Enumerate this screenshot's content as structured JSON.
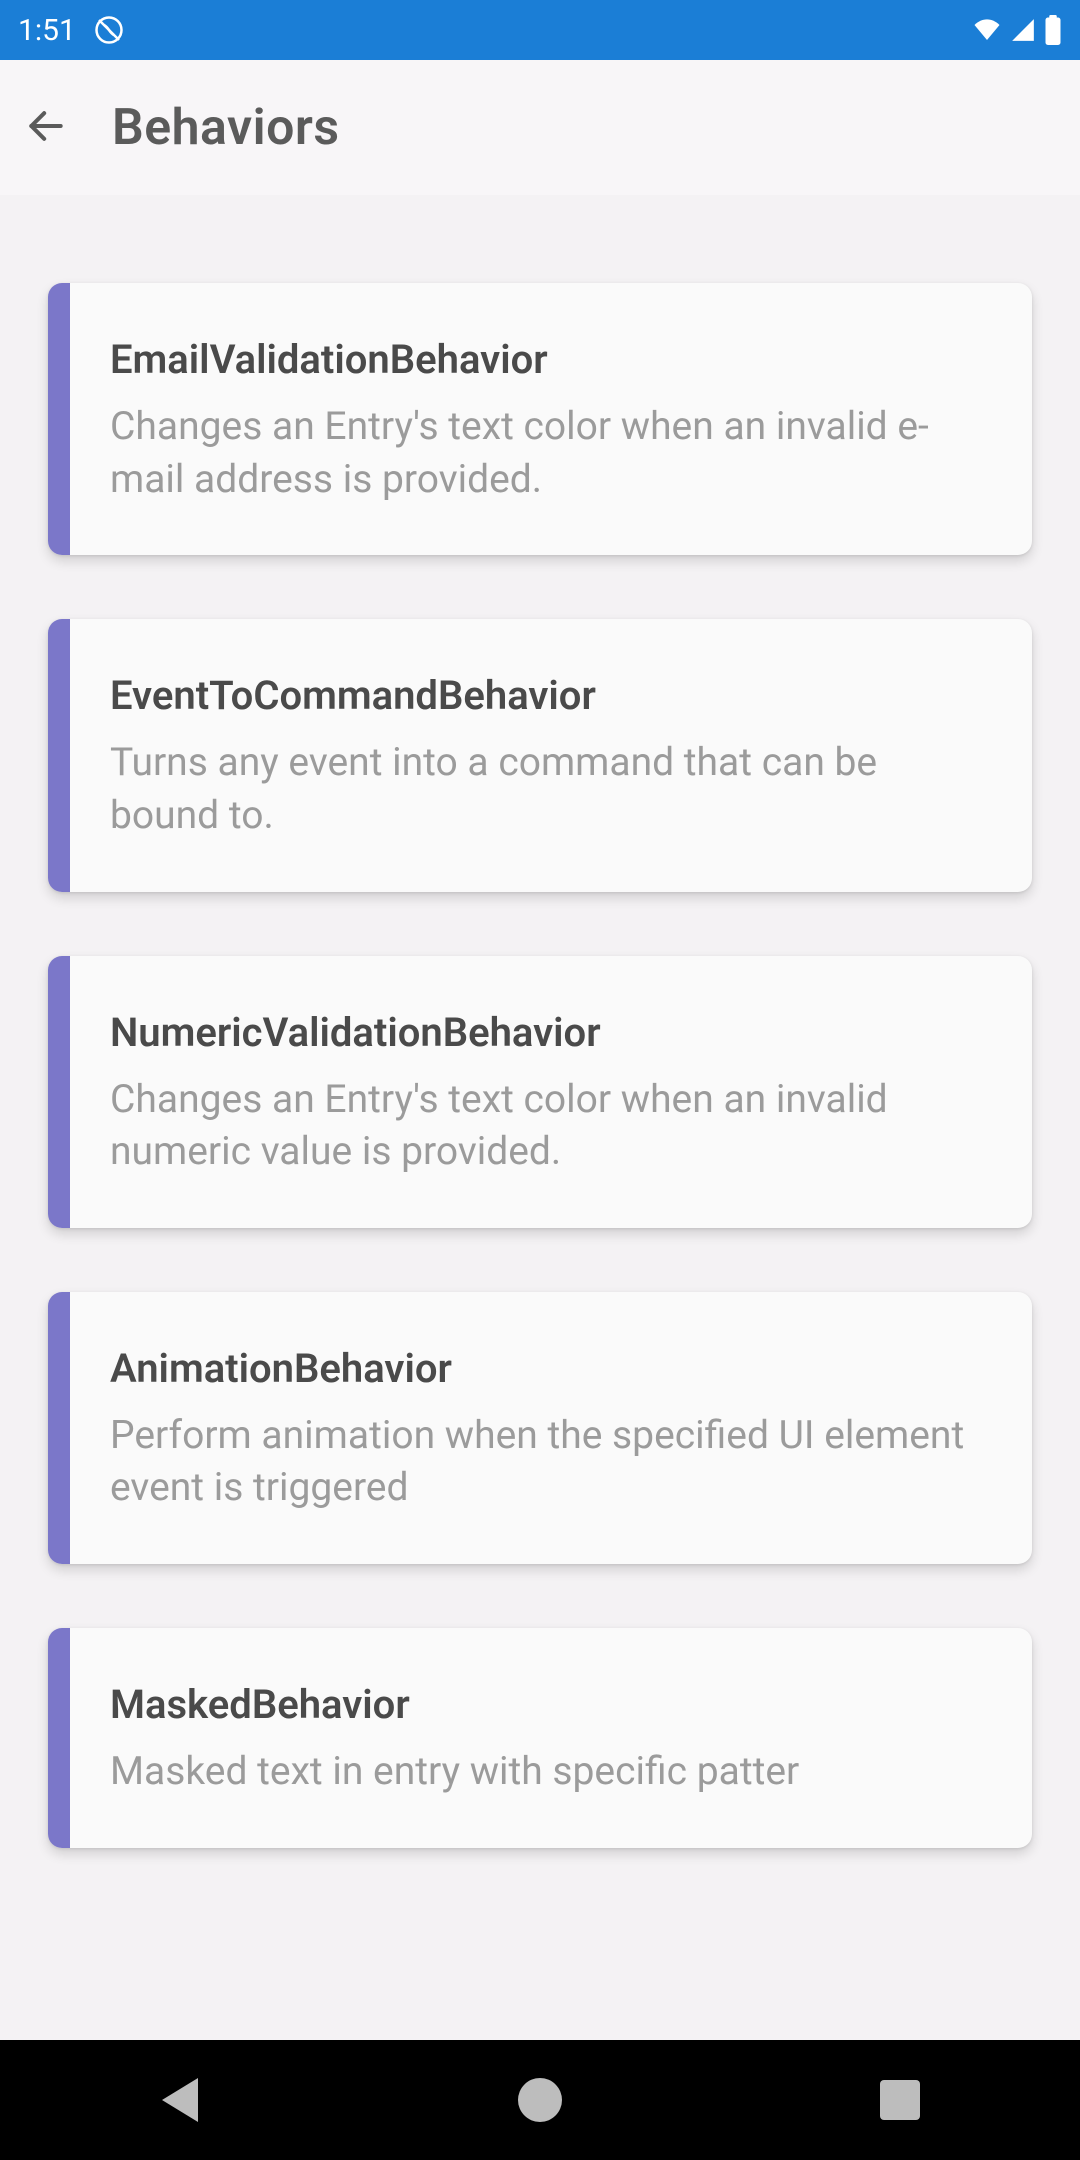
{
  "statusbar": {
    "time": "1:51"
  },
  "appbar": {
    "title": "Behaviors"
  },
  "cards": [
    {
      "title": "EmailValidationBehavior",
      "description": "Changes an Entry's text color when an invalid e-mail address is provided."
    },
    {
      "title": "EventToCommandBehavior",
      "description": "Turns any event into a command that can be bound to."
    },
    {
      "title": "NumericValidationBehavior",
      "description": "Changes an Entry's text color when an invalid numeric value is provided."
    },
    {
      "title": "AnimationBehavior",
      "description": "Perform animation when the specified UI element event is triggered"
    },
    {
      "title": "MaskedBehavior",
      "description": "Masked text in entry with specific patter"
    }
  ],
  "colors": {
    "statusbar": "#1b7ed6",
    "accent": "#7b77c9",
    "background": "#f4f2f4",
    "card": "#fafafa",
    "title": "#5b5b5b",
    "cardTitle": "#4a4a4a",
    "cardDesc": "#9b9b9b"
  }
}
